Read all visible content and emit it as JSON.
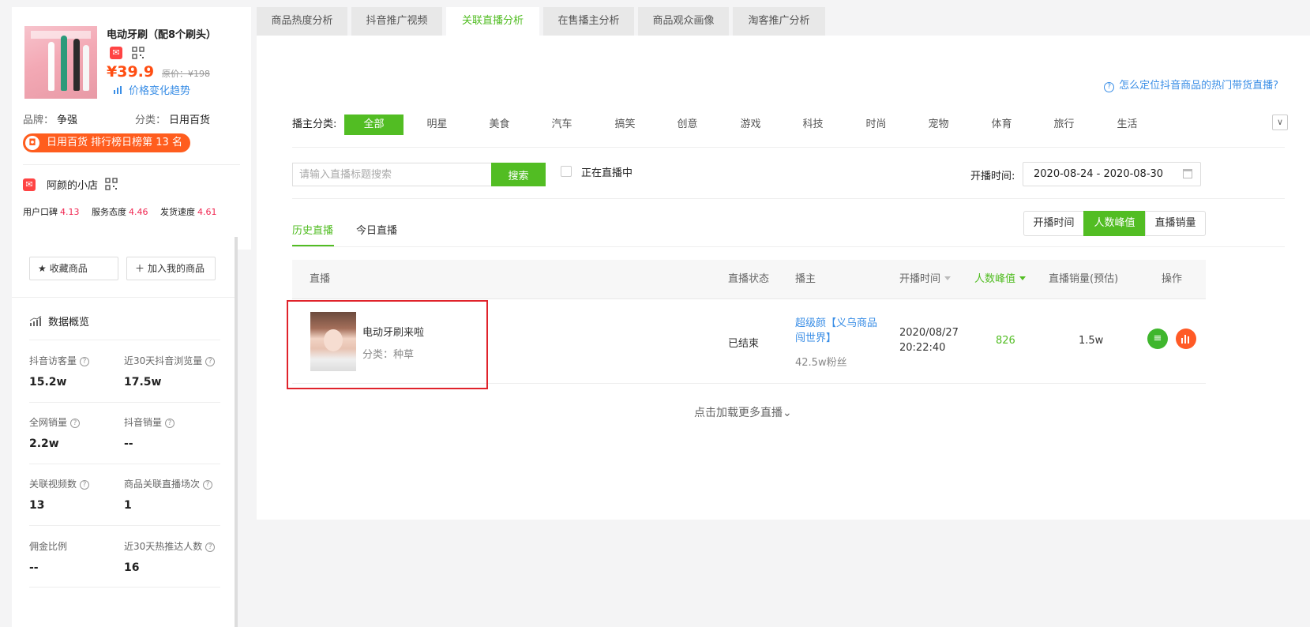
{
  "product": {
    "title": "电动牙刷（配8个刷头）",
    "price": "¥39.9",
    "original_price": "原价：¥198",
    "price_trend_link": "价格变化趋势",
    "brand_label": "品牌：",
    "brand": "争强",
    "category_label": "分类：",
    "category": "日用百货",
    "rank_badge": "日用百货 排行榜日榜第 13 名",
    "shop_name": "阿颜的小店",
    "scores": [
      {
        "label": "用户口碑",
        "value": "4.13"
      },
      {
        "label": "服务态度",
        "value": "4.46"
      },
      {
        "label": "发货速度",
        "value": "4.61"
      }
    ]
  },
  "actions": {
    "favorite": "收藏商品",
    "add_mine": "加入我的商品"
  },
  "overview": {
    "title": "数据概览",
    "stats": [
      {
        "label": "抖音访客量",
        "value": "15.2w",
        "help": true
      },
      {
        "label": "近30天抖音浏览量",
        "value": "17.5w",
        "help": true
      },
      {
        "label": "全网销量",
        "value": "2.2w",
        "help": true
      },
      {
        "label": "抖音销量",
        "value": "--",
        "help": true
      },
      {
        "label": "关联视频数",
        "value": "13",
        "help": true
      },
      {
        "label": "商品关联直播场次",
        "value": "1",
        "help": true
      },
      {
        "label": "佣金比例",
        "value": "--",
        "help": false
      },
      {
        "label": "近30天热推达人数",
        "value": "16",
        "help": true
      }
    ]
  },
  "tabs": [
    "商品热度分析",
    "抖音推广视频",
    "关联直播分析",
    "在售播主分析",
    "商品观众画像",
    "淘客推广分析"
  ],
  "active_tab": "关联直播分析",
  "help_link": "怎么定位抖音商品的热门带货直播?",
  "filter": {
    "category_label": "播主分类:",
    "categories": [
      "全部",
      "明星",
      "美食",
      "汽车",
      "搞笑",
      "创意",
      "游戏",
      "科技",
      "时尚",
      "宠物",
      "体育",
      "旅行",
      "生活"
    ],
    "active_category": "全部"
  },
  "search": {
    "placeholder": "请输入直播标题搜索",
    "value": "",
    "button": "搜索"
  },
  "live_now_label": "正在直播中",
  "live_now_checked": false,
  "date": {
    "label": "开播时间:",
    "range": "2020-08-24 - 2020-08-30"
  },
  "subtabs": [
    "历史直播",
    "今日直播"
  ],
  "active_subtab": "历史直播",
  "sort_buttons": [
    "开播时间",
    "人数峰值",
    "直播销量"
  ],
  "active_sort": "人数峰值",
  "table": {
    "headers": {
      "live": "直播",
      "status": "直播状态",
      "host": "播主",
      "start": "开播时间",
      "peak": "人数峰值",
      "sales": "直播销量(预估)",
      "ops": "操作"
    },
    "rows": [
      {
        "title": "电动牙刷来啦",
        "category": "分类：种草",
        "status": "已结束",
        "host": "超级颜【义乌商品闯世界】",
        "fans": "42.5w粉丝",
        "date": "2020/08/27",
        "time": "20:22:40",
        "peak": "826",
        "sales": "1.5w"
      }
    ]
  },
  "load_more": "点击加载更多直播",
  "colors": {
    "accent_green": "#52bd23",
    "price_orange": "#ff4d12",
    "link_blue": "#3a8ee6",
    "highlight_red": "#e0232b"
  }
}
